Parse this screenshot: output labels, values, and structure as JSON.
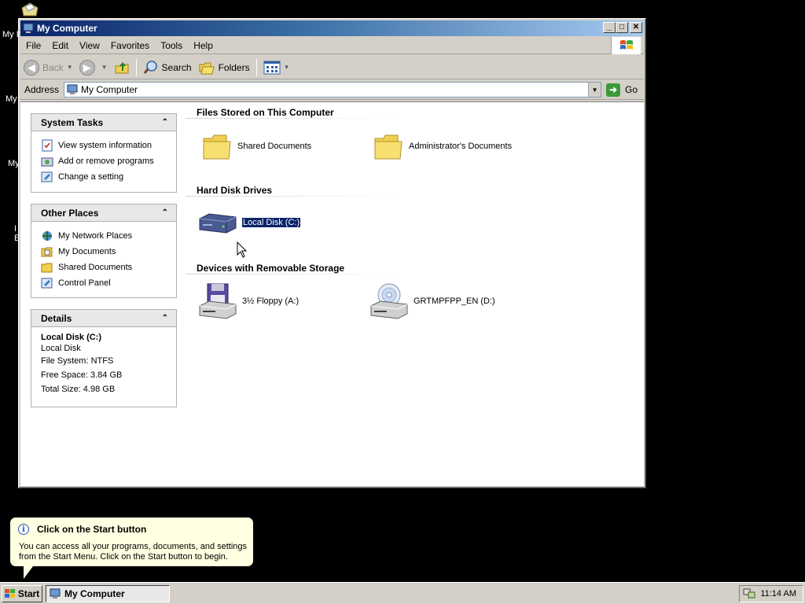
{
  "desktop": {
    "labels": [
      "My I",
      "My",
      "My",
      "I",
      "E"
    ]
  },
  "window": {
    "title": "My Computer",
    "controls": {
      "minimize": "_",
      "maximize": "□",
      "close": "✕"
    }
  },
  "menubar": {
    "items": [
      "File",
      "Edit",
      "View",
      "Favorites",
      "Tools",
      "Help"
    ]
  },
  "toolbar": {
    "back_label": "Back",
    "search_label": "Search",
    "folders_label": "Folders"
  },
  "address": {
    "label": "Address",
    "value": "My Computer",
    "go_label": "Go"
  },
  "tasks": {
    "system": {
      "title": "System Tasks",
      "links": [
        "View system information",
        "Add or remove programs",
        "Change a setting"
      ]
    },
    "other": {
      "title": "Other Places",
      "links": [
        "My Network Places",
        "My Documents",
        "Shared Documents",
        "Control Panel"
      ]
    },
    "details": {
      "title": "Details",
      "name": "Local Disk (C:)",
      "type": "Local Disk",
      "filesystem": "File System: NTFS",
      "free": "Free Space: 3.84 GB",
      "total": "Total Size: 4.98 GB"
    }
  },
  "sections": {
    "stored": {
      "title": "Files Stored on This Computer",
      "items": [
        "Shared Documents",
        "Administrator's Documents"
      ]
    },
    "hdd": {
      "title": "Hard Disk Drives",
      "items": [
        "Local Disk (C:)"
      ]
    },
    "removable": {
      "title": "Devices with Removable Storage",
      "items": [
        "3½ Floppy (A:)",
        "GRTMPFPP_EN (D:)"
      ]
    }
  },
  "balloon": {
    "title": "Click on the Start button",
    "body": "You can access all your programs, documents, and settings from the Start Menu. Click on the Start button to begin."
  },
  "taskbar": {
    "start_label": "Start",
    "task_label": "My Computer",
    "clock": "11:14 AM"
  }
}
